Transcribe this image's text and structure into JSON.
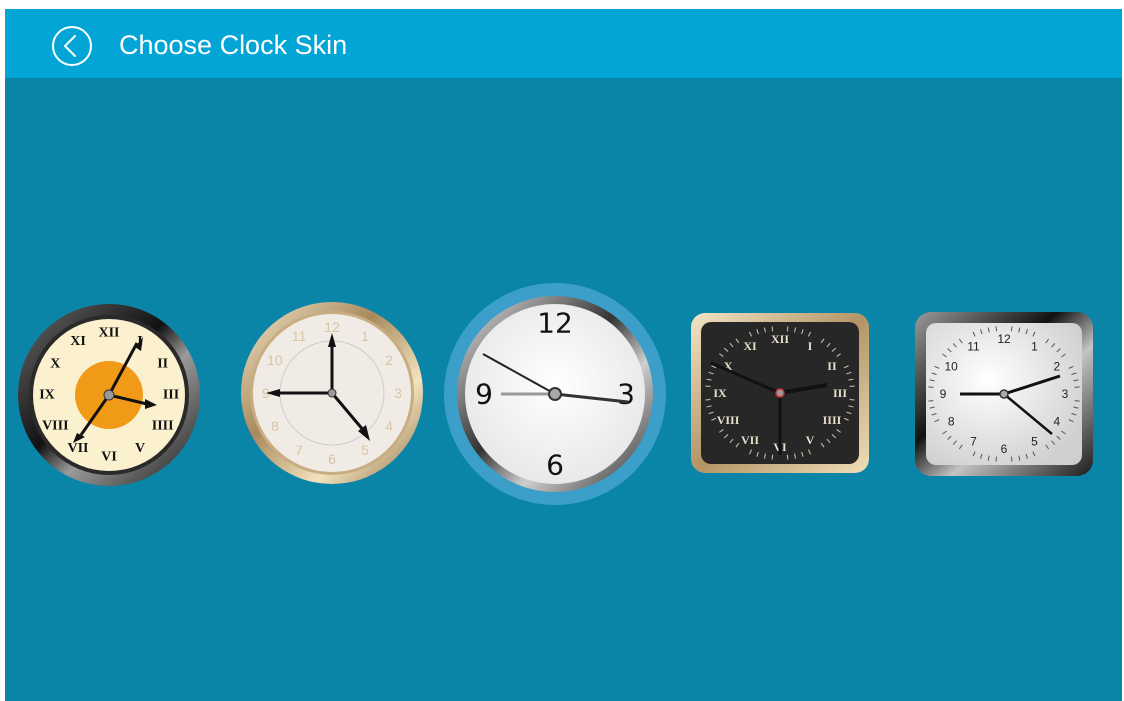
{
  "header": {
    "title": "Choose Clock Skin",
    "back_icon": "chevron-left-circle-icon"
  },
  "colors": {
    "background": "#0a85a8",
    "appbar": "#03a5d6",
    "selection_ring": "#3b9fc9"
  },
  "skins": [
    {
      "id": "vintage-roman",
      "numerals": [
        "XII",
        "I",
        "II",
        "III",
        "IIII",
        "V",
        "VI",
        "VII",
        "VIII",
        "IX",
        "X",
        "XI"
      ],
      "selected": false
    },
    {
      "id": "gold-arabic",
      "numerals": [
        "12",
        "1",
        "2",
        "3",
        "4",
        "5",
        "6",
        "7",
        "8",
        "9",
        "10",
        "11"
      ],
      "selected": false
    },
    {
      "id": "white-classic",
      "numerals": [
        "12",
        "3",
        "6",
        "9"
      ],
      "selected": true
    },
    {
      "id": "black-square-roman",
      "numerals": [
        "XII",
        "I",
        "II",
        "III",
        "IIII",
        "V",
        "VI",
        "VII",
        "VIII",
        "IX",
        "X",
        "XI"
      ],
      "selected": false
    },
    {
      "id": "chrome-square-arabic",
      "numerals": [
        "12",
        "1",
        "2",
        "3",
        "4",
        "5",
        "6",
        "7",
        "8",
        "9",
        "10",
        "11"
      ],
      "selected": false
    }
  ]
}
